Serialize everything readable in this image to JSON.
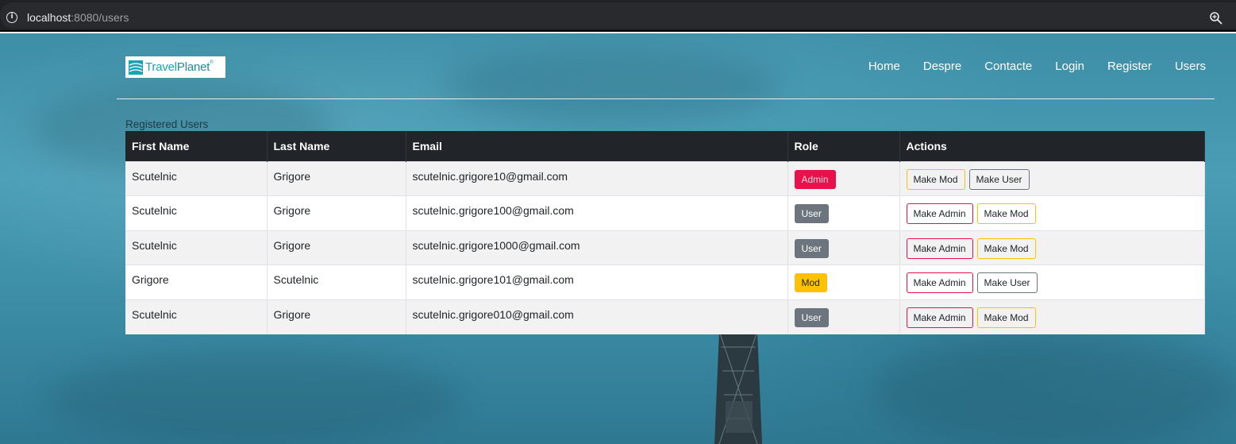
{
  "browser": {
    "url_host": "localhost",
    "url_path": ":8080/users",
    "info_icon": "info-icon",
    "zoom_icon": "zoom-icon"
  },
  "navbar": {
    "logo_text_part1": "Travel",
    "logo_text_part2": "Planet",
    "logo_reg": "®",
    "items": [
      {
        "label": "Home"
      },
      {
        "label": "Despre"
      },
      {
        "label": "Contacte"
      },
      {
        "label": "Login"
      },
      {
        "label": "Register"
      },
      {
        "label": "Users"
      }
    ]
  },
  "users_table": {
    "caption": "Registered Users",
    "headers": [
      "First Name",
      "Last Name",
      "Email",
      "Role",
      "Actions"
    ],
    "rows": [
      {
        "first_name": "Scutelnic",
        "last_name": "Grigore",
        "email": "scutelnic.grigore10@gmail.com",
        "role": "Admin",
        "actions": [
          "Make Mod",
          "Make User"
        ]
      },
      {
        "first_name": "Scutelnic",
        "last_name": "Grigore",
        "email": "scutelnic.grigore100@gmail.com",
        "role": "User",
        "actions": [
          "Make Admin",
          "Make Mod"
        ]
      },
      {
        "first_name": "Scutelnic",
        "last_name": "Grigore",
        "email": "scutelnic.grigore1000@gmail.com",
        "role": "User",
        "actions": [
          "Make Admin",
          "Make Mod"
        ]
      },
      {
        "first_name": "Grigore",
        "last_name": "Scutelnic",
        "email": "scutelnic.grigore101@gmail.com",
        "role": "Mod",
        "actions": [
          "Make Admin",
          "Make User"
        ]
      },
      {
        "first_name": "Scutelnic",
        "last_name": "Grigore",
        "email": "scutelnic.grigore010@gmail.com",
        "role": "User",
        "actions": [
          "Make Admin",
          "Make Mod"
        ]
      }
    ]
  },
  "colors": {
    "admin": "#e8114b",
    "user": "#6c757d",
    "mod": "#ffc107",
    "table_header": "#212529"
  }
}
